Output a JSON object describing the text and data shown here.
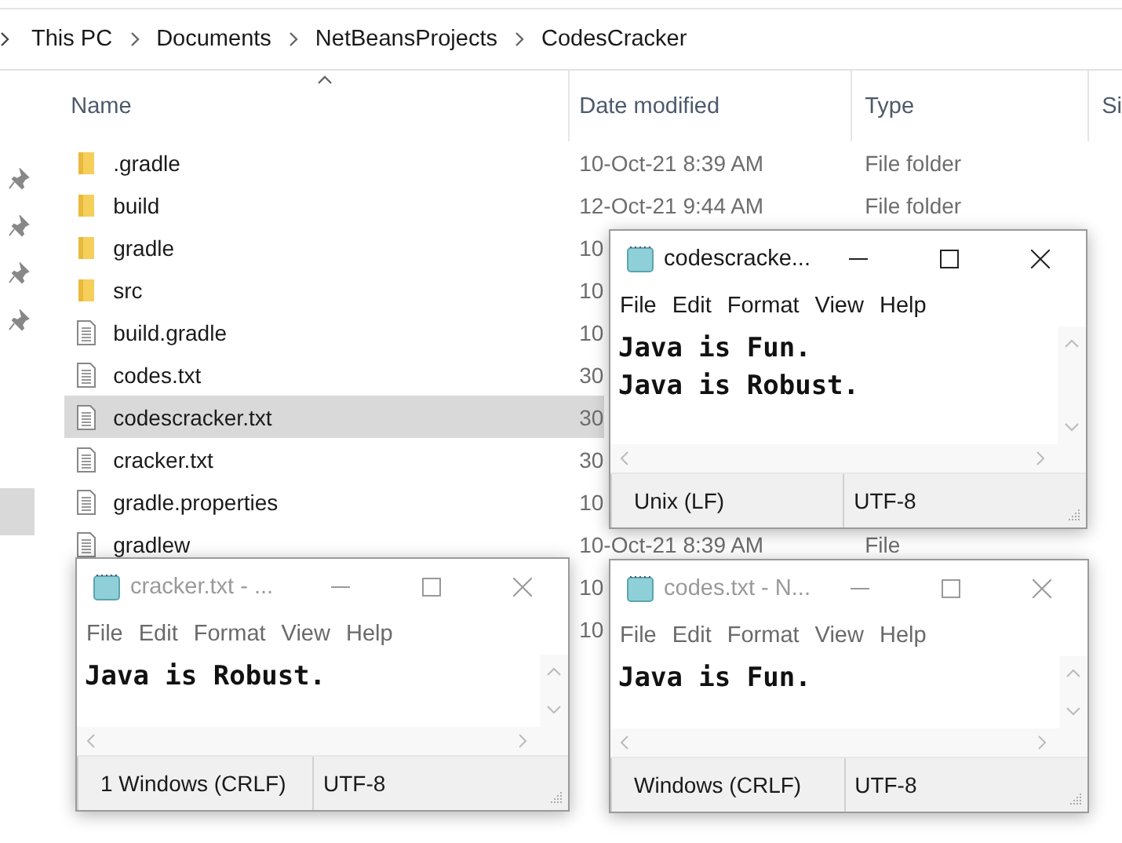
{
  "breadcrumb": [
    {
      "label": "This PC"
    },
    {
      "label": "Documents"
    },
    {
      "label": "NetBeansProjects"
    },
    {
      "label": "CodesCracker"
    }
  ],
  "columns": [
    {
      "label": "Name",
      "sorted": true
    },
    {
      "label": "Date modified",
      "sorted": false
    },
    {
      "label": "Type",
      "sorted": false
    },
    {
      "label": "Si",
      "sorted": false
    }
  ],
  "rows": [
    {
      "kind": "folder",
      "name": ".gradle",
      "date": "10-Oct-21 8:39 AM",
      "type": "File folder",
      "selected": false
    },
    {
      "kind": "folder",
      "name": "build",
      "date": "12-Oct-21 9:44 AM",
      "type": "File folder",
      "selected": false
    },
    {
      "kind": "folder",
      "name": "gradle",
      "date": "10",
      "selected": false
    },
    {
      "kind": "folder",
      "name": "src",
      "date": "10",
      "selected": false
    },
    {
      "kind": "file",
      "name": "build.gradle",
      "date": "10",
      "selected": false
    },
    {
      "kind": "file",
      "name": "codes.txt",
      "date": "30",
      "selected": false
    },
    {
      "kind": "file",
      "name": "codescracker.txt",
      "date": "30",
      "selected": true
    },
    {
      "kind": "file",
      "name": "cracker.txt",
      "date": "30",
      "selected": false
    },
    {
      "kind": "file",
      "name": "gradle.properties",
      "date": "10",
      "selected": false
    },
    {
      "kind": "file",
      "name": "gradlew",
      "date": "10-Oct-21 8:39 AM",
      "type": "File",
      "selected": false
    },
    {
      "date": "10",
      "selected": false
    },
    {
      "date": "10",
      "selected": false
    }
  ],
  "windows": [
    {
      "title": "codescracke...",
      "active": true,
      "menu": [
        "File",
        "Edit",
        "Format",
        "View",
        "Help"
      ],
      "lines": [
        "Java is Fun.",
        "Java is Robust."
      ],
      "status": [
        "Unix (LF)",
        "UTF-8"
      ]
    },
    {
      "title": "cracker.txt - ...",
      "active": false,
      "menu": [
        "File",
        "Edit",
        "Format",
        "View",
        "Help"
      ],
      "lines": [
        "Java is Robust."
      ],
      "status": [
        "1 Windows (CRLF)",
        "UTF-8"
      ]
    },
    {
      "title": "codes.txt - N...",
      "active": false,
      "menu": [
        "File",
        "Edit",
        "Format",
        "View",
        "Help"
      ],
      "lines": [
        "Java is Fun."
      ],
      "status": [
        "Windows (CRLF)",
        "UTF-8"
      ]
    }
  ]
}
